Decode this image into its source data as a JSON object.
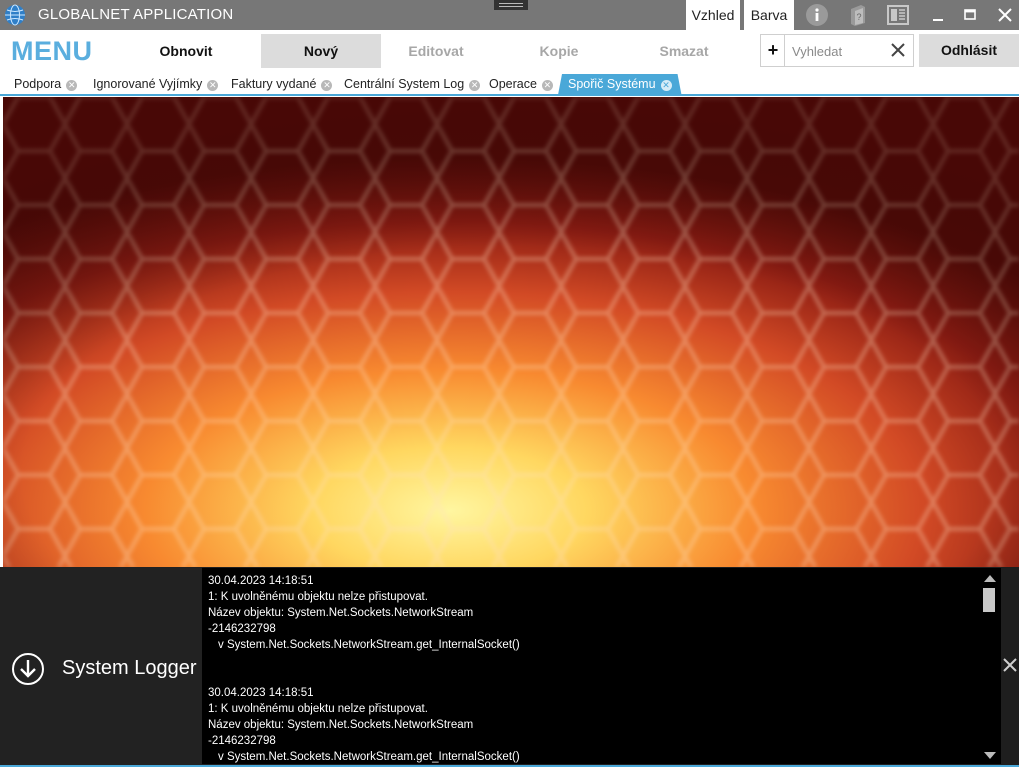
{
  "window": {
    "title": "GLOBALNET APPLICATION",
    "theme_tabs": [
      "Vzhled",
      "Barva"
    ]
  },
  "menu": {
    "logo": "MENU",
    "buttons": [
      {
        "label": "Obnovit",
        "state": "active"
      },
      {
        "label": "Nový",
        "state": "selected"
      },
      {
        "label": "Editovat",
        "state": "disabled"
      },
      {
        "label": "Kopie",
        "state": "disabled"
      },
      {
        "label": "Smazat",
        "state": "disabled"
      }
    ],
    "add_label": "+",
    "search": {
      "placeholder": "Vyhledat",
      "value": ""
    },
    "logout_label": "Odhlásit"
  },
  "tabs": [
    {
      "label": "Podpora",
      "active": false
    },
    {
      "label": "Ignorované Vyjímky",
      "active": false
    },
    {
      "label": "Faktury vydané",
      "active": false
    },
    {
      "label": "Centrální System Log",
      "active": false
    },
    {
      "label": "Operace",
      "active": false
    },
    {
      "label": "Spořič Systému",
      "active": true
    }
  ],
  "logger": {
    "title": "System Logger",
    "entries": [
      {
        "timestamp": "30.04.2023 14:18:51",
        "message": "1: K uvolněnému objektu nelze přistupovat.",
        "object": "Název objektu: System.Net.Sockets.NetworkStream",
        "code": "-2146232798",
        "stack": "v System.Net.Sockets.NetworkStream.get_InternalSocket()"
      },
      {
        "timestamp": "30.04.2023 14:18:51",
        "message": "1: K uvolněnému objektu nelze přistupovat.",
        "object": "Název objektu: System.Net.Sockets.NetworkStream",
        "code": "-2146232798",
        "stack": "v System.Net.Sockets.NetworkStream.get_InternalSocket()"
      }
    ]
  },
  "colors": {
    "accent": "#4aa8d8",
    "menu_logo": "#5aaede",
    "titlebar": "#777777",
    "logger_bg": "#000000"
  },
  "icons": {
    "app": "globe-icon",
    "info": "info-icon",
    "help": "help-book-icon",
    "layout": "layout-icon",
    "minimize": "minimize-icon",
    "maximize": "maximize-icon",
    "close": "close-icon",
    "logger_toggle": "arrow-down-circle-icon"
  }
}
